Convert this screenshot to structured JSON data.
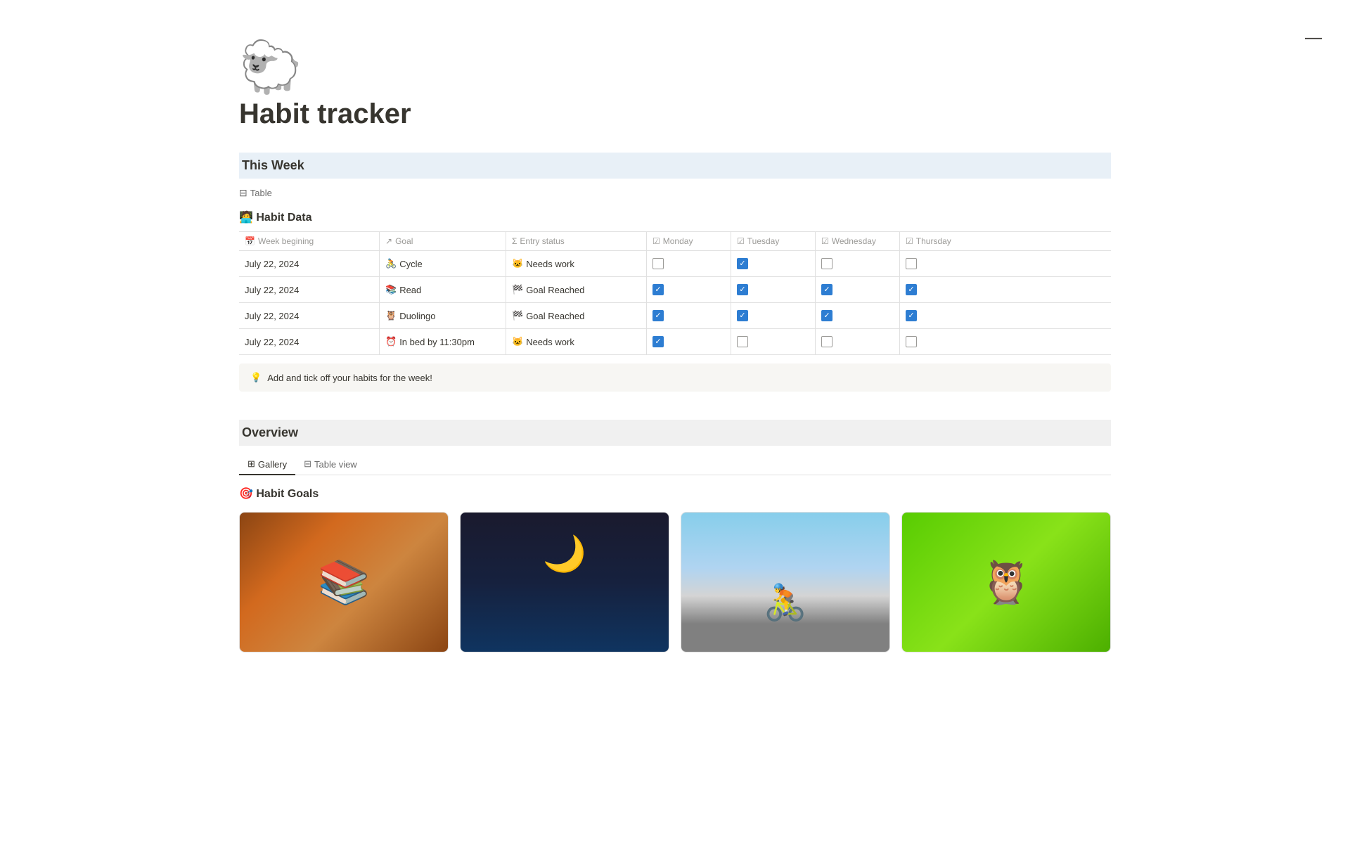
{
  "page": {
    "icon": "🐑",
    "title": "Habit tracker",
    "minimize_btn": "—"
  },
  "this_week": {
    "title": "This Week",
    "view_label": "Table",
    "habit_data_title": "🧑‍💻 Habit Data",
    "columns": [
      {
        "icon": "📅",
        "label": "Week begining"
      },
      {
        "icon": "↗",
        "label": "Goal"
      },
      {
        "icon": "Σ",
        "label": "Entry status"
      },
      {
        "icon": "☑",
        "label": "Monday"
      },
      {
        "icon": "☑",
        "label": "Tuesday"
      },
      {
        "icon": "☑",
        "label": "Wednesday"
      },
      {
        "icon": "☑",
        "label": "Thursday"
      }
    ],
    "rows": [
      {
        "date": "July 22, 2024",
        "goal_icon": "🚴",
        "goal": "Cycle",
        "status_icon": "🐱",
        "status": "Needs work",
        "monday": false,
        "tuesday": true,
        "wednesday": false,
        "thursday": false
      },
      {
        "date": "July 22, 2024",
        "goal_icon": "📚",
        "goal": "Read",
        "status_icon": "🏁",
        "status": "Goal Reached",
        "monday": true,
        "tuesday": true,
        "wednesday": true,
        "thursday": true
      },
      {
        "date": "July 22, 2024",
        "goal_icon": "🦉",
        "goal": "Duolingo",
        "status_icon": "🏁",
        "status": "Goal Reached",
        "monday": true,
        "tuesday": true,
        "wednesday": true,
        "thursday": true
      },
      {
        "date": "July 22, 2024",
        "goal_icon": "⏰",
        "goal": "In bed by 11:30pm",
        "status_icon": "🐱",
        "status": "Needs work",
        "monday": true,
        "tuesday": false,
        "wednesday": false,
        "thursday": false
      }
    ],
    "tip_icon": "💡",
    "tip_text": "Add and tick off your habits for the week!"
  },
  "overview": {
    "title": "Overview",
    "tabs": [
      {
        "icon": "⊞",
        "label": "Gallery",
        "active": true
      },
      {
        "icon": "⊟",
        "label": "Table view",
        "active": false
      }
    ],
    "habit_goals_title": "🎯 Habit Goals",
    "cards": [
      {
        "label": "Books",
        "type": "img-books"
      },
      {
        "label": "Night",
        "type": "img-night"
      },
      {
        "label": "Cycle",
        "type": "img-cycle"
      },
      {
        "label": "Duolingo",
        "type": "img-duolingo"
      }
    ]
  }
}
